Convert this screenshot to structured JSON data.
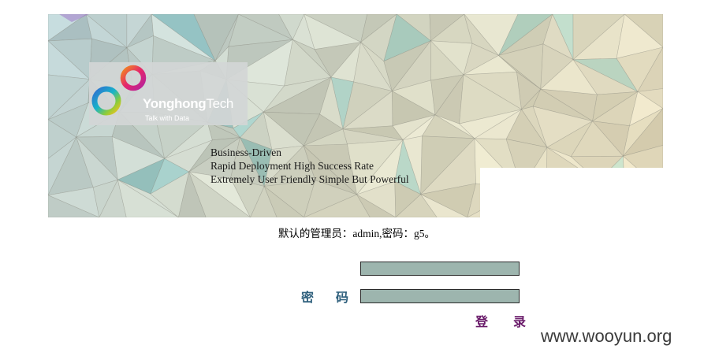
{
  "colors": {
    "input_bg": "#9db5ae",
    "label_color": "#2e5f7c",
    "login_color": "#6a1b6a",
    "banner_base": "#cfd9cf"
  },
  "banner": {
    "logo": {
      "name_bold": "Yonghong",
      "name_light": "Tech",
      "tagline": "Talk with Data",
      "icon": "yonghong-rings-logo"
    },
    "slogans": [
      "Business-Driven",
      "Rapid Deployment High Success Rate",
      "Extremely User Friendly Simple But Powerful"
    ]
  },
  "hint": "默认的管理员：admin,密码：g5。",
  "form": {
    "username": {
      "label": "",
      "value": ""
    },
    "password": {
      "label": "密 码",
      "value": ""
    },
    "login_label": "登 录"
  },
  "watermark": "www.wooyun.org"
}
